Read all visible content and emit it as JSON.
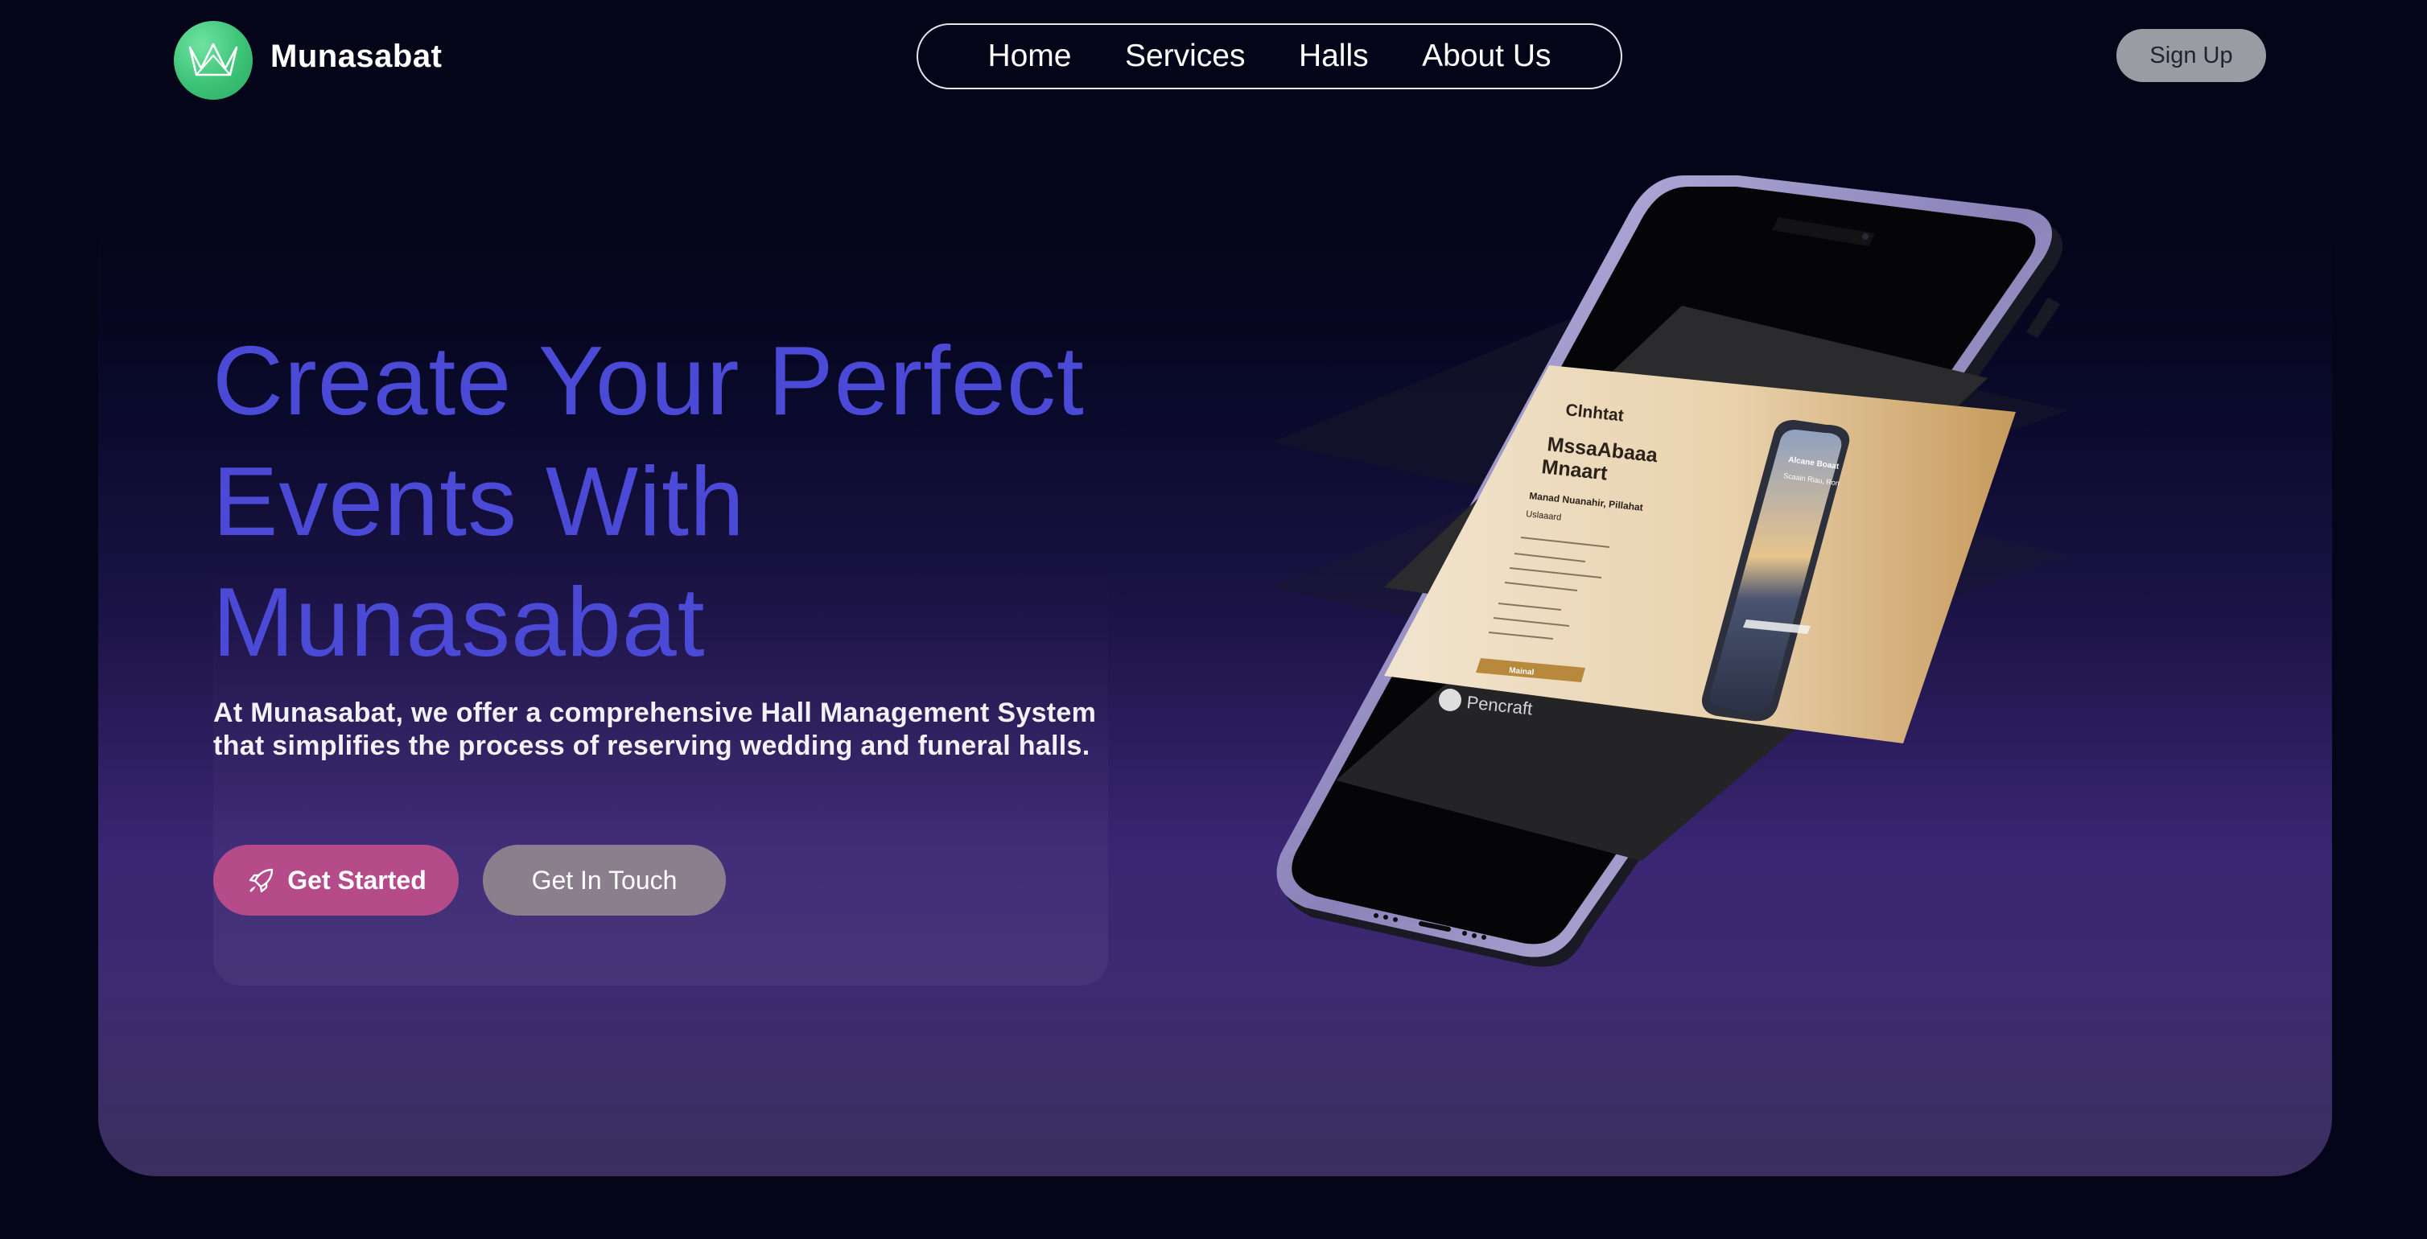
{
  "header": {
    "brand": "Munasabat",
    "logo_icon": "crown-icon",
    "nav": [
      "Home",
      "Services",
      "Halls",
      "About Us"
    ],
    "signup_label": "Sign Up"
  },
  "hero": {
    "headline_lines": [
      "Create Your Perfect",
      "Events With",
      "Munasabat"
    ],
    "description": "At Munasabat, we offer a comprehensive Hall Management System that simplifies the process of reserving wedding and funeral halls.",
    "get_started_label": "Get Started",
    "get_started_icon": "rocket-icon",
    "get_in_touch_label": "Get In Touch"
  },
  "phone_mockup": {
    "screen_texts": [
      "Clnhtat",
      "MssaAbaaa",
      "Mnaart",
      "Manad Nuanahir, Pillahat",
      "Uslaaard",
      "Mainal"
    ],
    "inner_phone_texts": [
      "Alcane Boaat",
      "Scaain Riau, Ron"
    ],
    "watermark": "Pencraft"
  },
  "colors": {
    "background": "#05051a",
    "headline": "#4b4ad6",
    "brand_green": "#3cc277",
    "get_started": "#b54b88",
    "get_in_touch": "#8c7f8d",
    "signup": "#9b9ca3"
  }
}
